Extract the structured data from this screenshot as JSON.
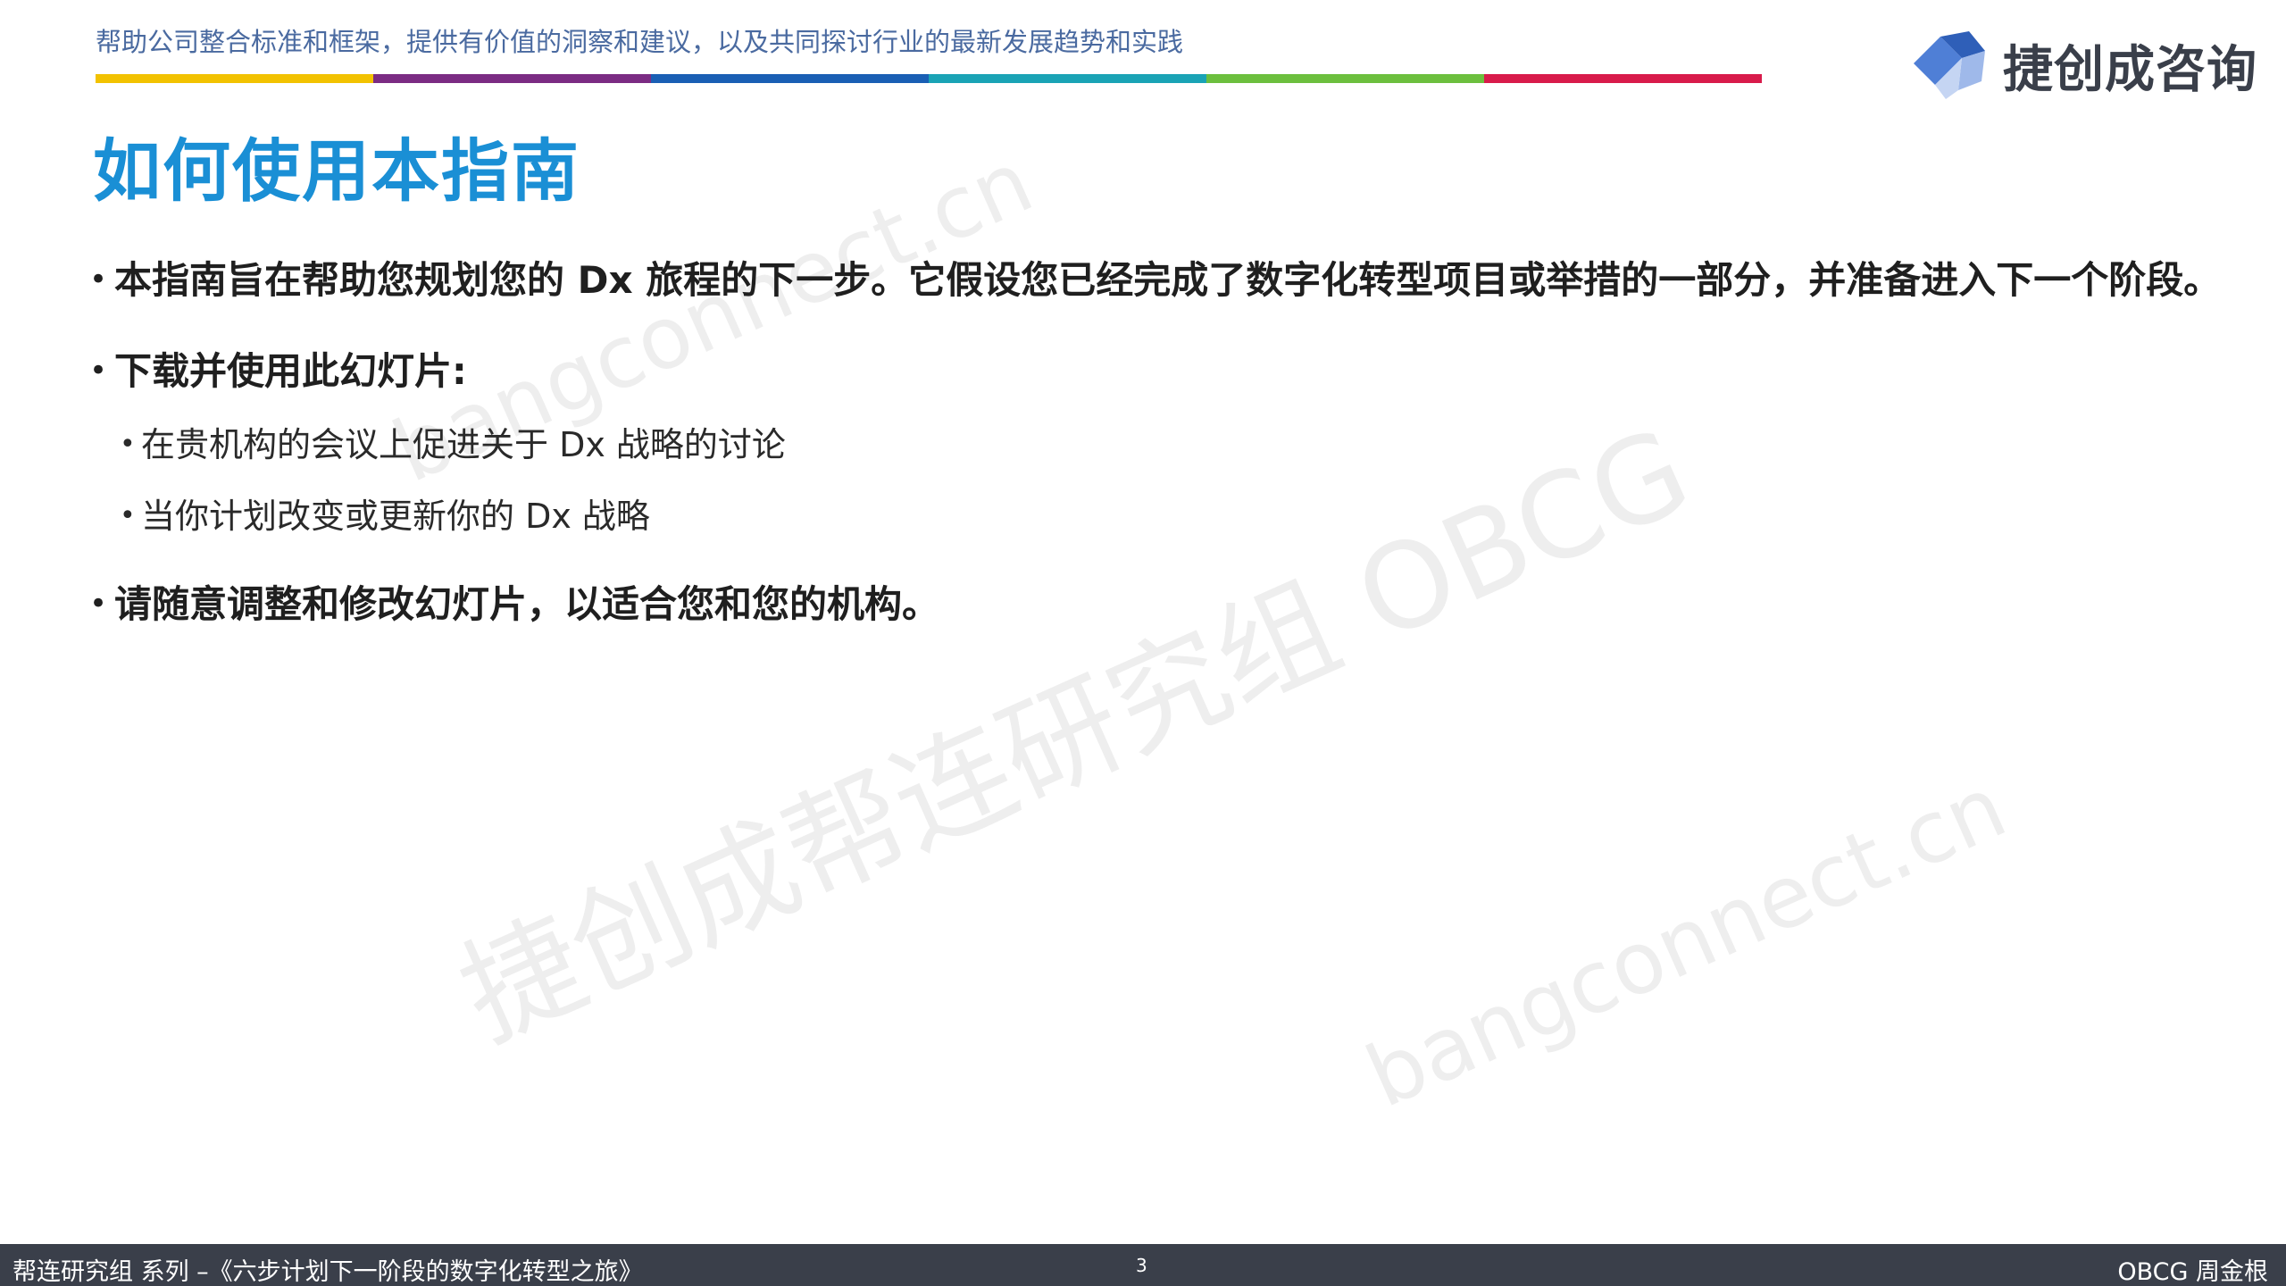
{
  "header": {
    "tagline": "帮助公司整合标准和框架，提供有价值的洞察和建议，以及共同探讨行业的最新发展趋势和实践",
    "color_bar": [
      "#f2c200",
      "#7b2c83",
      "#1a5fb4",
      "#1aa3b5",
      "#6cbf3e",
      "#d81b4b"
    ],
    "logo_icon": "blue-cube-icon",
    "logo_text": "捷创成咨询"
  },
  "main": {
    "title": "如何使用本指南",
    "bullets": [
      {
        "level": 1,
        "text": "本指南旨在帮助您规划您的 Dx 旅程的下一步。它假设您已经完成了数字化转型项目或举措的一部分，并准备进入下一个阶段。"
      },
      {
        "level": 1,
        "text": "下载并使用此幻灯片:"
      },
      {
        "level": 2,
        "text": "在贵机构的会议上促进关于 Dx 战略的讨论"
      },
      {
        "level": 2,
        "text": "当你计划改变或更新你的 Dx 战略"
      },
      {
        "level": 1,
        "text": "请随意调整和修改幻灯片，以适合您和您的机构。"
      }
    ],
    "bullet_glyph": "•"
  },
  "watermark": {
    "main": "捷创成帮连研究组 OBCG",
    "url": "bangconnect.cn"
  },
  "footer": {
    "left": "帮连研究组 系列  –《六步计划下一阶段的数字化转型之旅》",
    "page_number": "3",
    "right": "OBCG 周金根"
  },
  "colors": {
    "title": "#1a8fd5",
    "tagline": "#4a6aa0",
    "footer_bg": "#3a3f4a",
    "logo_blue": "#4f7fd6",
    "logo_light": "#9fb9ea"
  }
}
